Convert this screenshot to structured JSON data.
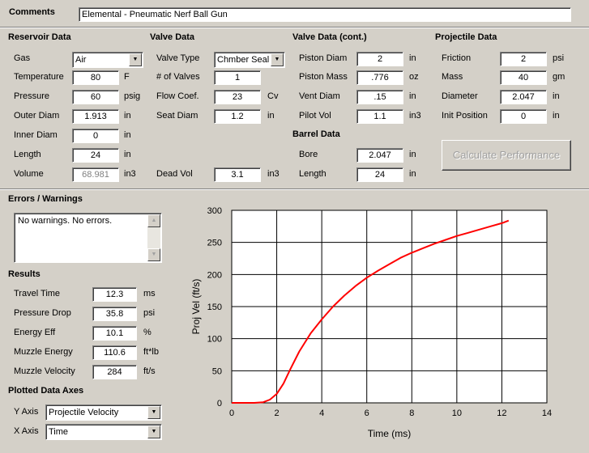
{
  "comments": {
    "label": "Comments",
    "value": "Elemental - Pneumatic Nerf Ball Gun"
  },
  "reservoir": {
    "title": "Reservoir Data",
    "gas_label": "Gas",
    "gas_value": "Air",
    "temperature_label": "Temperature",
    "temperature_value": "80",
    "temperature_unit": "F",
    "pressure_label": "Pressure",
    "pressure_value": "60",
    "pressure_unit": "psig",
    "outer_diam_label": "Outer Diam",
    "outer_diam_value": "1.913",
    "outer_diam_unit": "in",
    "inner_diam_label": "Inner Diam",
    "inner_diam_value": "0",
    "inner_diam_unit": "in",
    "length_label": "Length",
    "length_value": "24",
    "length_unit": "in",
    "volume_label": "Volume",
    "volume_value": "68.981",
    "volume_unit": "in3"
  },
  "valve": {
    "title": "Valve Data",
    "type_label": "Valve Type",
    "type_value": "Chmber Seal",
    "num_label": "# of Valves",
    "num_value": "1",
    "flow_label": "Flow Coef.",
    "flow_value": "23",
    "flow_unit": "Cv",
    "seat_label": "Seat Diam",
    "seat_value": "1.2",
    "seat_unit": "in",
    "dead_label": "Dead Vol",
    "dead_value": "3.1",
    "dead_unit": "in3"
  },
  "valve_cont": {
    "title": "Valve Data (cont.)",
    "piston_diam_label": "Piston Diam",
    "piston_diam_value": "2",
    "piston_diam_unit": "in",
    "piston_mass_label": "Piston Mass",
    "piston_mass_value": ".776",
    "piston_mass_unit": "oz",
    "vent_label": "Vent Diam",
    "vent_value": ".15",
    "vent_unit": "in",
    "pilot_label": "Pilot Vol",
    "pilot_value": "1.1",
    "pilot_unit": "in3"
  },
  "barrel": {
    "title": "Barrel Data",
    "bore_label": "Bore",
    "bore_value": "2.047",
    "bore_unit": "in",
    "length_label": "Length",
    "length_value": "24",
    "length_unit": "in"
  },
  "projectile": {
    "title": "Projectile Data",
    "friction_label": "Friction",
    "friction_value": "2",
    "friction_unit": "psi",
    "mass_label": "Mass",
    "mass_value": "40",
    "mass_unit": "gm",
    "diameter_label": "Diameter",
    "diameter_value": "2.047",
    "diameter_unit": "in",
    "init_label": "Init Position",
    "init_value": "0",
    "init_unit": "in"
  },
  "calculate_button": "Calculate Performance",
  "errors": {
    "title": "Errors / Warnings",
    "text": "No warnings.  No errors."
  },
  "results": {
    "title": "Results",
    "travel_label": "Travel Time",
    "travel_value": "12.3",
    "travel_unit": "ms",
    "pdrop_label": "Pressure Drop",
    "pdrop_value": "35.8",
    "pdrop_unit": "psi",
    "eff_label": "Energy Eff",
    "eff_value": "10.1",
    "eff_unit": "%",
    "energy_label": "Muzzle Energy",
    "energy_value": "110.6",
    "energy_unit": "ft*lb",
    "velocity_label": "Muzzle Velocity",
    "velocity_value": "284",
    "velocity_unit": "ft/s"
  },
  "axes": {
    "title": "Plotted Data Axes",
    "y_label": "Y Axis",
    "y_value": "Projectile Velocity",
    "x_label": "X Axis",
    "x_value": "Time"
  },
  "colors": {
    "curve": "#ff0000",
    "background": "#d4d0c8"
  },
  "chart_data": {
    "type": "line",
    "xlabel": "Time (ms)",
    "ylabel": "Proj Vel (ft/s)",
    "xlim": [
      0,
      14
    ],
    "ylim": [
      0,
      300
    ],
    "xticks": [
      "0",
      "2",
      "4",
      "6",
      "8",
      "10",
      "12",
      "14"
    ],
    "yticks": [
      "0",
      "50",
      "100",
      "150",
      "200",
      "250",
      "300"
    ],
    "grid": true,
    "series": [
      {
        "x": [
          0,
          1.0,
          1.4,
          1.7,
          2.0,
          2.3,
          2.6,
          3.0,
          3.5,
          4.0,
          4.5,
          5.0,
          5.5,
          6.0,
          6.5,
          7.0,
          7.5,
          8.0,
          8.5,
          9.0,
          9.5,
          10.0,
          10.5,
          11.0,
          11.5,
          12.0,
          12.3
        ],
        "y": [
          0,
          0,
          1,
          5,
          14,
          30,
          52,
          80,
          108,
          130,
          150,
          167,
          182,
          195,
          206,
          216,
          226,
          234,
          241,
          248,
          254,
          260,
          265,
          270,
          275,
          280,
          284
        ]
      }
    ]
  }
}
